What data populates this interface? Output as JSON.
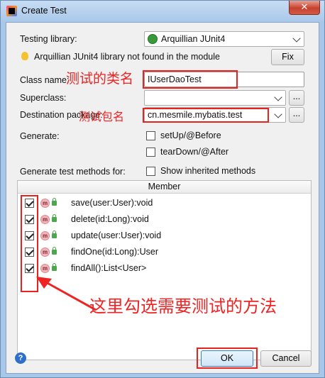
{
  "window": {
    "title": "Create Test",
    "close_label": "✕"
  },
  "form": {
    "testing_library_label": "Testing library:",
    "testing_library_value": "Arquillian JUnit4",
    "warning_text": "Arquillian JUnit4 library not found in the module",
    "fix_label": "Fix",
    "class_name_label": "Class name:",
    "class_name_value": "IUserDaoTest",
    "superclass_label": "Superclass:",
    "superclass_value": "",
    "destination_label": "Destination package:",
    "destination_value": "cn.mesmile.mybatis.test",
    "browse_label": "...",
    "generate_label": "Generate:",
    "setup_label": "setUp/@Before",
    "teardown_label": "tearDown/@After",
    "methods_label": "Generate test methods for:",
    "inherited_label": "Show inherited methods"
  },
  "table": {
    "header": "Member",
    "rows": [
      {
        "signature": "save(user:User):void"
      },
      {
        "signature": "delete(id:Long):void"
      },
      {
        "signature": "update(user:User):void"
      },
      {
        "signature": "findOne(id:Long):User"
      },
      {
        "signature": "findAll():List<User>"
      }
    ],
    "method_icon_letter": "m"
  },
  "annotations": {
    "class_name": "测试的类名",
    "package": "测试包名",
    "methods": "这里勾选需要测试的方法",
    "color": "#ee2424"
  },
  "footer": {
    "ok_label": "OK",
    "cancel_label": "Cancel",
    "help_label": "?"
  }
}
